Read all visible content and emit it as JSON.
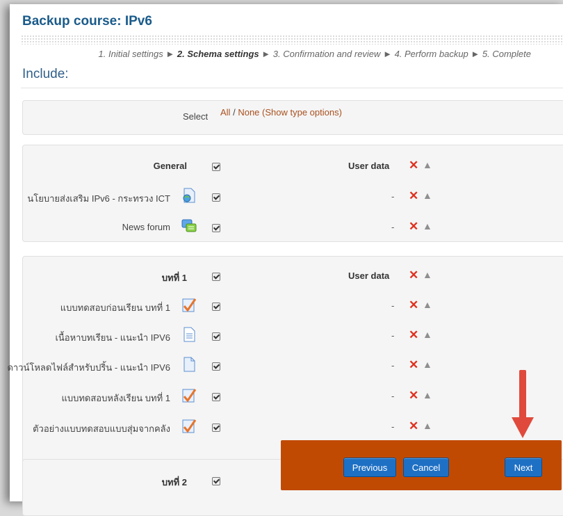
{
  "page": {
    "title": "Backup course: IPv6",
    "include_heading": "Include:"
  },
  "steps": {
    "s1": "1. Initial settings",
    "s2": "2. Schema settings",
    "s3": "3. Confirmation and review",
    "s4": "4. Perform backup",
    "s5": "5. Complete",
    "sep": "►"
  },
  "select": {
    "label": "Select",
    "all": "All",
    "slash": "/",
    "none": "None",
    "show_types": "(Show type options)"
  },
  "sections": {
    "general": {
      "title": "General",
      "user_data": "User data",
      "items": [
        {
          "label": "นโยบายส่งเสริม IPv6 - กระทรวง ICT",
          "icon": "url-icon"
        },
        {
          "label": "News forum",
          "icon": "forum-icon"
        }
      ]
    },
    "topic1": {
      "title": "บทที่ 1",
      "user_data": "User data",
      "items": [
        {
          "label": "แบบทดสอบก่อนเรียน บทที่ 1",
          "icon": "quiz-icon"
        },
        {
          "label": "เนื้อหาบทเรียน - แนะนำ IPV6",
          "icon": "page-icon"
        },
        {
          "label": "ดาวน์โหลดไฟล์สำหรับปริ้น - แนะนำ IPV6",
          "icon": "file-icon"
        },
        {
          "label": "แบบทดสอบหลังเรียน บทที่ 1",
          "icon": "quiz-icon"
        },
        {
          "label": "ตัวอย่างแบบทดสอบแบบสุ่มจากคลัง",
          "icon": "quiz-icon"
        }
      ]
    },
    "topic2": {
      "title": "บทที่ 2"
    }
  },
  "dash": "-",
  "buttons": {
    "previous": "Previous",
    "cancel": "Cancel",
    "next": "Next"
  },
  "colors": {
    "title": "#1a5b8a",
    "link": "#a9501e",
    "button": "#1e70c4",
    "button_bar": "#c14a02",
    "arrow": "#e04a3c",
    "delete_icon": "#e0301e"
  }
}
